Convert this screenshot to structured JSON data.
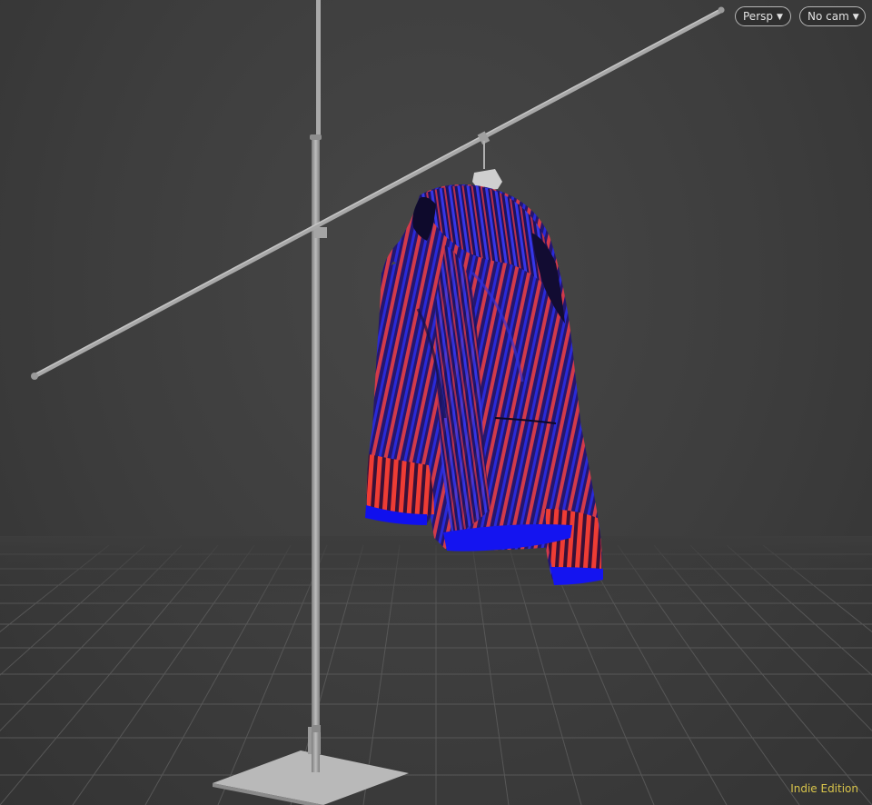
{
  "viewport": {
    "view_menu": {
      "label": "Persp",
      "icon": "chevron-down-icon"
    },
    "camera_menu": {
      "label": "No cam",
      "icon": "chevron-down-icon"
    },
    "edition_label": "Indie Edition"
  },
  "colors": {
    "background": "#3d3d3d",
    "grid_line": "#5a5a5a",
    "stand": "#9c9c9c",
    "cloth_base": "#2a1a7a",
    "cloth_red": "#e03a3a",
    "cloth_blue": "#1a1ae0",
    "edition_text": "#d8c44b"
  }
}
